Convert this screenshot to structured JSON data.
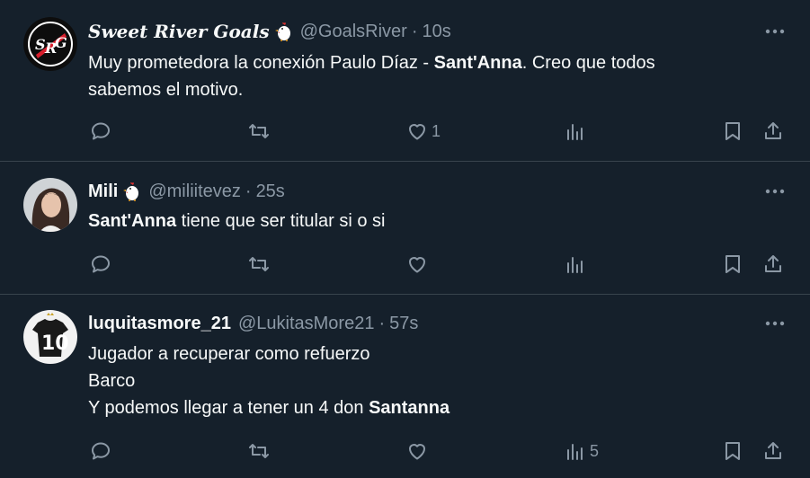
{
  "colors": {
    "background": "#15202b",
    "divider": "#38444d",
    "text_primary": "#f7f9f9",
    "text_secondary": "#8b98a5"
  },
  "tweets": [
    {
      "display_name": "Sweet River Goals",
      "name_emoji": "chicken-emoji",
      "handle": "@GoalsRiver",
      "separator": "·",
      "time": "10s",
      "avatar_icon": "river-crest-avatar",
      "text_lines": [
        {
          "segments": [
            {
              "text": "Muy prometedora la conexión Paulo Díaz - ",
              "bold": false
            },
            {
              "text": "Sant'Anna",
              "bold": true
            },
            {
              "text": ". Creo que todos",
              "bold": false
            }
          ]
        },
        {
          "segments": [
            {
              "text": "sabemos el motivo.",
              "bold": false
            }
          ]
        }
      ],
      "replies": "",
      "retweets": "",
      "likes": "1",
      "views": ""
    },
    {
      "display_name": "Mili",
      "name_emoji": "chicken-emoji",
      "handle": "@miliitevez",
      "separator": "·",
      "time": "25s",
      "avatar_icon": "user-photo-avatar",
      "text_lines": [
        {
          "segments": [
            {
              "text": "Sant'Anna",
              "bold": true
            },
            {
              "text": " tiene que ser titular si o si",
              "bold": false
            }
          ]
        }
      ],
      "replies": "",
      "retweets": "",
      "likes": "",
      "views": ""
    },
    {
      "display_name": "luquitasmore_21",
      "name_emoji": "",
      "handle": "@LukitasMore21",
      "separator": "·",
      "time": "57s",
      "avatar_icon": "jersey-10-avatar",
      "text_lines": [
        {
          "segments": [
            {
              "text": "Jugador a recuperar como refuerzo",
              "bold": false
            }
          ]
        },
        {
          "segments": [
            {
              "text": "Barco",
              "bold": false
            }
          ]
        },
        {
          "segments": [
            {
              "text": "Y podemos llegar a tener un 4 don ",
              "bold": false
            },
            {
              "text": "Santanna",
              "bold": true
            }
          ]
        }
      ],
      "replies": "",
      "retweets": "",
      "likes": "",
      "views": "5"
    }
  ]
}
